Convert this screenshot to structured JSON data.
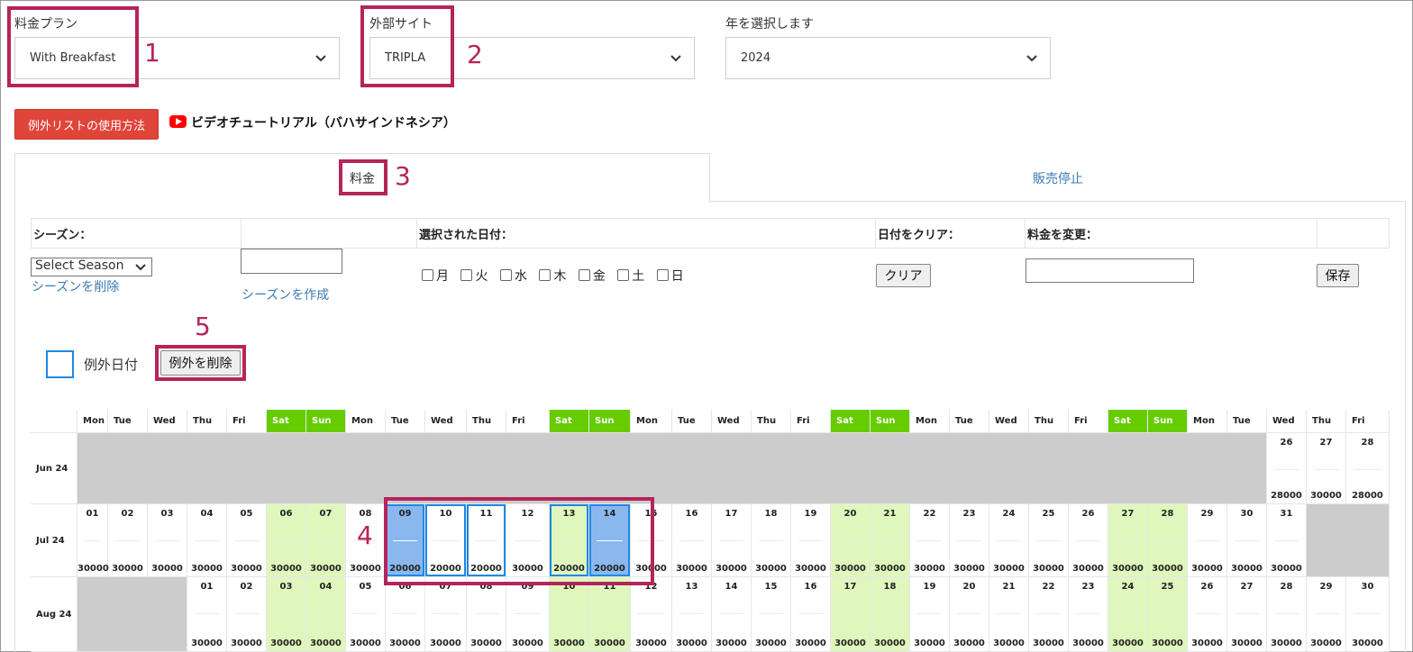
{
  "filters": {
    "rate_plan": {
      "label": "料金プラン",
      "value": "With Breakfast"
    },
    "external_site": {
      "label": "外部サイト",
      "value": "TRIPLA"
    },
    "year": {
      "label": "年を選択します",
      "value": "2024"
    }
  },
  "help": {
    "button_label": "例外リストの使用方法",
    "video_link": "ビデオチュートリアル（バハサインドネシア）"
  },
  "tabs": [
    {
      "label": "料金"
    },
    {
      "label": "販売停止"
    }
  ],
  "table_header": {
    "season": "シーズン：",
    "selected_dates": "選択された日付：",
    "clear_dates": "日付をクリア：",
    "change_rate": "料金を変更："
  },
  "controls": {
    "season_select": "Select Season",
    "delete_season": "シーズンを削除",
    "create_season": "シーズンを作成",
    "days": [
      "月",
      "火",
      "水",
      "木",
      "金",
      "土",
      "日"
    ],
    "clear_button": "クリア",
    "save_button": "保存"
  },
  "legend": {
    "exception_label": "例外日付",
    "delete_exception_button": "例外を削除"
  },
  "annotations": [
    "1",
    "2",
    "3",
    "4",
    "5"
  ],
  "colors": {
    "annotation": "#b5245a",
    "weekend_header": "#66cc00",
    "weekend_cell": "#dff7bd",
    "selected_cell": "#8ab8ee",
    "exception_border": "#1e88e5",
    "help_button": "#e0453a"
  },
  "calendar": {
    "weekdays": [
      "Mon",
      "Tue",
      "Wed",
      "Thu",
      "Fri",
      "Sat",
      "Sun",
      "Mon",
      "Tue",
      "Wed",
      "Thu",
      "Fri",
      "Sat",
      "Sun",
      "Mon",
      "Tue",
      "Wed",
      "Thu",
      "Fri",
      "Sat",
      "Sun",
      "Mon",
      "Tue",
      "Wed",
      "Thu",
      "Fri",
      "Sat",
      "Sun",
      "Mon",
      "Tue",
      "Wed",
      "Thu",
      "Fri"
    ],
    "months": [
      {
        "label": "Jun 24",
        "days": [
          {
            "col": 30,
            "day": "26",
            "price": "28000"
          },
          {
            "col": 31,
            "day": "27",
            "price": "30000"
          },
          {
            "col": 32,
            "day": "28",
            "price": "28000"
          }
        ]
      },
      {
        "label": "Jul 24",
        "days": [
          {
            "col": 0,
            "day": "01",
            "price": "30000"
          },
          {
            "col": 1,
            "day": "02",
            "price": "30000"
          },
          {
            "col": 2,
            "day": "03",
            "price": "30000"
          },
          {
            "col": 3,
            "day": "04",
            "price": "30000"
          },
          {
            "col": 4,
            "day": "05",
            "price": "30000"
          },
          {
            "col": 5,
            "day": "06",
            "price": "30000"
          },
          {
            "col": 6,
            "day": "07",
            "price": "30000"
          },
          {
            "col": 7,
            "day": "08",
            "price": "30000"
          },
          {
            "col": 8,
            "day": "09",
            "price": "20000",
            "selected": true,
            "exception": true
          },
          {
            "col": 9,
            "day": "10",
            "price": "20000",
            "exception": true
          },
          {
            "col": 10,
            "day": "11",
            "price": "20000",
            "exception": true
          },
          {
            "col": 11,
            "day": "12",
            "price": "30000"
          },
          {
            "col": 12,
            "day": "13",
            "price": "20000",
            "exception": true
          },
          {
            "col": 13,
            "day": "14",
            "price": "20000",
            "selected": true,
            "exception": true
          },
          {
            "col": 14,
            "day": "15",
            "price": "30000"
          },
          {
            "col": 15,
            "day": "16",
            "price": "30000"
          },
          {
            "col": 16,
            "day": "17",
            "price": "30000"
          },
          {
            "col": 17,
            "day": "18",
            "price": "30000"
          },
          {
            "col": 18,
            "day": "19",
            "price": "30000"
          },
          {
            "col": 19,
            "day": "20",
            "price": "30000"
          },
          {
            "col": 20,
            "day": "21",
            "price": "30000"
          },
          {
            "col": 21,
            "day": "22",
            "price": "30000"
          },
          {
            "col": 22,
            "day": "23",
            "price": "30000"
          },
          {
            "col": 23,
            "day": "24",
            "price": "30000"
          },
          {
            "col": 24,
            "day": "25",
            "price": "30000"
          },
          {
            "col": 25,
            "day": "26",
            "price": "30000"
          },
          {
            "col": 26,
            "day": "27",
            "price": "30000"
          },
          {
            "col": 27,
            "day": "28",
            "price": "30000"
          },
          {
            "col": 28,
            "day": "29",
            "price": "30000"
          },
          {
            "col": 29,
            "day": "30",
            "price": "30000"
          },
          {
            "col": 30,
            "day": "31",
            "price": "30000"
          }
        ]
      },
      {
        "label": "Aug 24",
        "days": [
          {
            "col": 3,
            "day": "01",
            "price": "30000"
          },
          {
            "col": 4,
            "day": "02",
            "price": "30000"
          },
          {
            "col": 5,
            "day": "03",
            "price": "30000"
          },
          {
            "col": 6,
            "day": "04",
            "price": "30000"
          },
          {
            "col": 7,
            "day": "05",
            "price": "30000"
          },
          {
            "col": 8,
            "day": "06",
            "price": "30000"
          },
          {
            "col": 9,
            "day": "07",
            "price": "30000"
          },
          {
            "col": 10,
            "day": "08",
            "price": "30000"
          },
          {
            "col": 11,
            "day": "09",
            "price": "30000"
          },
          {
            "col": 12,
            "day": "10",
            "price": "30000"
          },
          {
            "col": 13,
            "day": "11",
            "price": "30000"
          },
          {
            "col": 14,
            "day": "12",
            "price": "30000"
          },
          {
            "col": 15,
            "day": "13",
            "price": "30000"
          },
          {
            "col": 16,
            "day": "14",
            "price": "30000"
          },
          {
            "col": 17,
            "day": "15",
            "price": "30000"
          },
          {
            "col": 18,
            "day": "16",
            "price": "30000"
          },
          {
            "col": 19,
            "day": "17",
            "price": "30000"
          },
          {
            "col": 20,
            "day": "18",
            "price": "30000"
          },
          {
            "col": 21,
            "day": "19",
            "price": "30000"
          },
          {
            "col": 22,
            "day": "20",
            "price": "30000"
          },
          {
            "col": 23,
            "day": "21",
            "price": "30000"
          },
          {
            "col": 24,
            "day": "22",
            "price": "30000"
          },
          {
            "col": 25,
            "day": "23",
            "price": "30000"
          },
          {
            "col": 26,
            "day": "24",
            "price": "30000"
          },
          {
            "col": 27,
            "day": "25",
            "price": "30000"
          },
          {
            "col": 28,
            "day": "26",
            "price": "30000"
          },
          {
            "col": 29,
            "day": "27",
            "price": "30000"
          },
          {
            "col": 30,
            "day": "28",
            "price": "30000"
          },
          {
            "col": 31,
            "day": "29",
            "price": "30000"
          },
          {
            "col": 32,
            "day": "30",
            "price": "30000"
          }
        ]
      }
    ]
  }
}
